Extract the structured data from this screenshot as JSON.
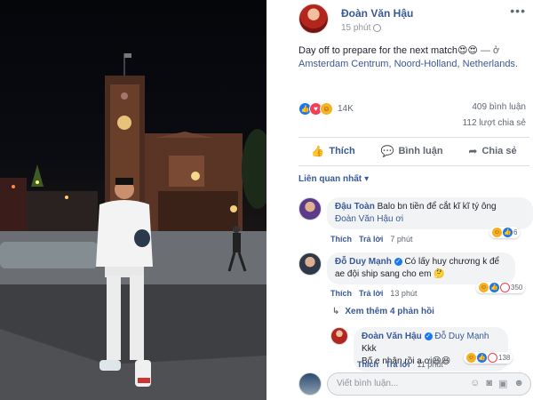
{
  "post": {
    "author": "Đoàn Văn Hậu",
    "time": "15 phút",
    "text": "Day off to prepare for the next match😍😍",
    "at_sep": " — ở ",
    "location": "Amsterdam Centrum, Noord-Holland, Netherlands.",
    "reaction_count": "14K",
    "comments_count": "409 bình luận",
    "shares_count": "112 lượt chia sẻ",
    "reactions": [
      "like",
      "love",
      "haha"
    ]
  },
  "actions": {
    "like": "Thích",
    "comment": "Bình luận",
    "share": "Chia sẻ"
  },
  "sort_label": "Liên quan nhất",
  "comments": [
    {
      "name": "Đậu Toàn",
      "text_1": "Balo bn tiền để cắt kĩ kĩ tý ông",
      "text_2": "Đoàn Văn Hậu ơi",
      "like": "Thích",
      "reply": "Trả lời",
      "time": "7 phút",
      "react_count": "6"
    },
    {
      "name": "Đỗ Duy Mạnh",
      "text_1": "Có lấy huy chương k để",
      "text_2": "ae đội ship sang cho em 🤔",
      "like": "Thích",
      "reply": "Trả lời",
      "time": "13 phút",
      "react_count": "350"
    }
  ],
  "more_replies": "Xem thêm 4 phản hồi",
  "reply": {
    "name": "Đoàn Văn Hậu",
    "tag": "Đỗ Duy Mạnh",
    "text_1": "Kkk",
    "text_2": "Bố e nhận rồi a ơi😆😆",
    "like": "Thích",
    "reply": "Trả lời",
    "time": "11 phút",
    "react_count": "138"
  },
  "write_placeholder": "Viết bình luận...",
  "colors": {
    "link": "#385898",
    "like_blue": "#1877f2",
    "love_red": "#f33e58",
    "haha_yellow": "#f7b125"
  }
}
